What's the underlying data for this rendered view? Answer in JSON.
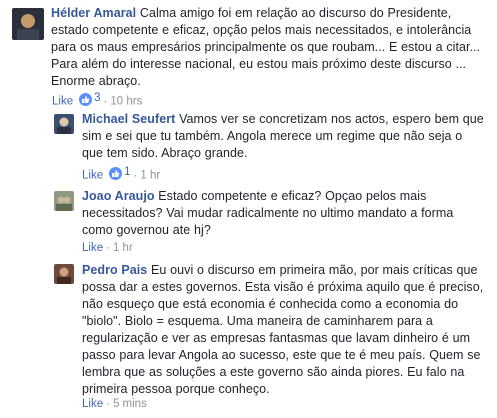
{
  "comments": [
    {
      "author": "Hélder Amaral",
      "text": "Calma amigo foi em relação ao discurso do Presidente, estado competente e eficaz, opção pelos mais necessitados, e intolerância para os maus empresários principalmente os que roubam... E estou a citar... Para além do interesse nacional, eu estou mais próximo deste discurso ... Enorme abraço.",
      "like_label": "Like",
      "reaction_count": "3",
      "time": "10 hrs",
      "avatar_colors": [
        "#2a2f3a",
        "#c79a6b",
        "#3b4250"
      ]
    },
    {
      "author": "Michael Seufert",
      "text": "Vamos ver se concretizam nos actos, espero bem que sim e sei que tu também. Angola merece um regime que não seja o que tem sido. Abraço grande.",
      "like_label": "Like",
      "reaction_count": "1",
      "time": "1 hr",
      "avatar_colors": [
        "#3d4f6e",
        "#e0c5a8",
        "#2b3140"
      ]
    },
    {
      "author": "Joao Araujo",
      "text": "Estado competente e eficaz? Opçao pelos mais necessitados? Vai mudar radicalmente no ultimo mandato a forma como governou ate hj?",
      "like_label": "Like",
      "time": "1 hr",
      "avatar_colors": [
        "#8a9a7e",
        "#5b6b4f",
        "#c8b79e"
      ]
    },
    {
      "author": "Pedro Pais",
      "text": "Eu ouvi o discurso em primeira mão, por mais críticas que possa dar a estes governos. Esta visão é próxima aquilo que é preciso, não esqueço que está economia é conhecida como a economia do \"biolo\". Biolo = esquema. Uma maneira de caminharem para a regularização e ver as empresas fantasmas que lavam dinheiro é um passo para levar Angola ao sucesso, este que te é meu país. Quem se lembra que as soluções a este governo são ainda piores. Eu falo na primeira pessoa porque conheço.",
      "like_label": "Like",
      "time": "5 mins",
      "avatar_colors": [
        "#6d4a3a",
        "#d2a07a",
        "#402a20"
      ]
    }
  ],
  "colors": {
    "author": "#365899",
    "text": "#1d2129",
    "meta": "#90949c",
    "link": "#4267b2",
    "reaction": "#5890ff"
  }
}
